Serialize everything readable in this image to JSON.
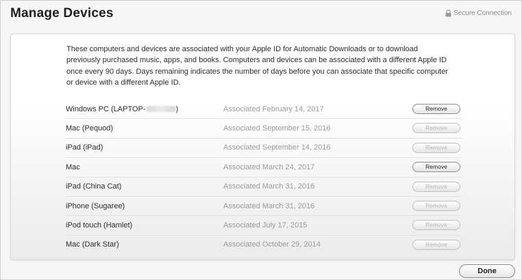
{
  "header": {
    "title": "Manage Devices",
    "secure_label": "Secure Connection",
    "secure_icon": "lock-icon"
  },
  "intro": "These computers and devices are associated with your Apple ID for Automatic Downloads or to download previously purchased music, apps, and books. Computers and devices can be associated with a different Apple ID once every 90 days. Days remaining indicates the number of days before you can associate that specific computer or device with a different Apple ID.",
  "devices": [
    {
      "name_prefix": "Windows PC (LAPTOP-",
      "name_suffix": ")",
      "redacted": true,
      "associated": "Associated February 14, 2017",
      "remove_label": "Remove",
      "remove_enabled": true
    },
    {
      "name": "Mac (Pequod)",
      "associated": "Associated September 15, 2016",
      "remove_label": "Remove",
      "remove_enabled": false
    },
    {
      "name": "iPad (iPad)",
      "associated": "Associated September 14, 2016",
      "remove_label": "Remove",
      "remove_enabled": false
    },
    {
      "name": "Mac",
      "associated": "Associated March 24, 2017",
      "remove_label": "Remove",
      "remove_enabled": true
    },
    {
      "name": "iPad (China Cat)",
      "associated": "Associated March 31, 2016",
      "remove_label": "Remove",
      "remove_enabled": false
    },
    {
      "name": "iPhone (Sugaree)",
      "associated": "Associated March 31, 2016",
      "remove_label": "Remove",
      "remove_enabled": false
    },
    {
      "name": "iPod touch (Hamlet)",
      "associated": "Associated July 17, 2015",
      "remove_label": "Remove",
      "remove_enabled": false
    },
    {
      "name": "Mac (Dark Star)",
      "associated": "Associated October 29, 2014",
      "remove_label": "Remove",
      "remove_enabled": false
    }
  ],
  "footer": {
    "done_label": "Done"
  }
}
